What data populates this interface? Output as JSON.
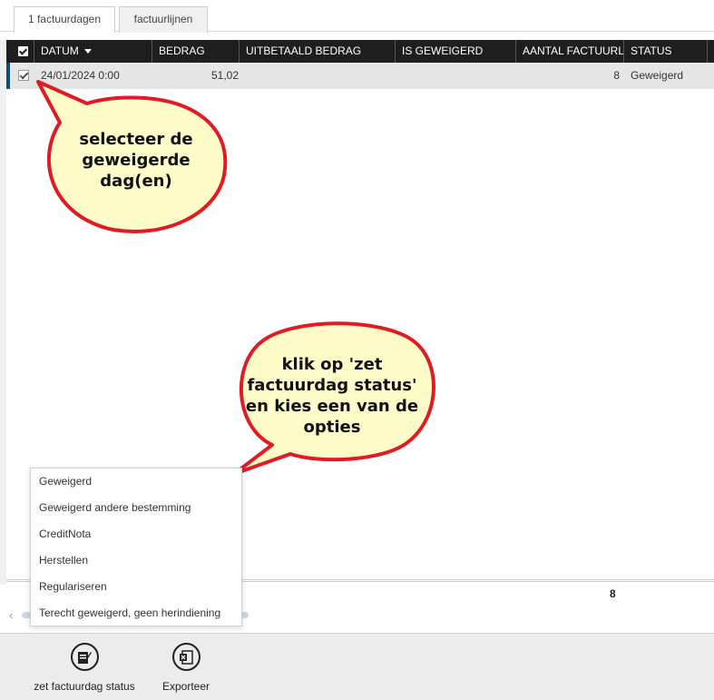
{
  "tabs": [
    {
      "label": "1 factuurdagen",
      "active": true
    },
    {
      "label": "factuurlijnen",
      "active": false
    }
  ],
  "grid": {
    "columns": [
      "DATUM",
      "BEDRAG",
      "UITBETAALD BEDRAG",
      "IS GEWEIGERD",
      "AANTAL FACTUURL",
      "STATUS"
    ],
    "sort_column": "DATUM",
    "rows": [
      {
        "selected": true,
        "datum": "24/01/2024 0:00",
        "bedrag": "51,02",
        "uitbetaald": "",
        "is_geweigerd": "",
        "aantal": "8",
        "status": "Geweigerd"
      }
    ],
    "footer_total": "8"
  },
  "status_menu": {
    "items": [
      "Geweigerd",
      "Geweigerd andere bestemming",
      "CreditNota",
      "Herstellen",
      "Regulariseren",
      "Terecht geweigerd, geen herindiening"
    ]
  },
  "toolbar": {
    "set_status_label": "zet factuurdag status",
    "set_status_icon": "edit-document-icon",
    "export_label": "Exporteer",
    "export_icon": "excel-icon"
  },
  "callouts": {
    "select_text": "selecteer de geweigerde dag(en)",
    "click_text": "klik op 'zet factuurdag status' en kies een van de opties"
  },
  "colors": {
    "header_bg": "#1e1e1e",
    "row_selected_bg": "#e6e6e6",
    "row_marker": "#0b4f7a",
    "bubble_fill": "#fefcc8",
    "bubble_stroke": "#e01b24"
  }
}
